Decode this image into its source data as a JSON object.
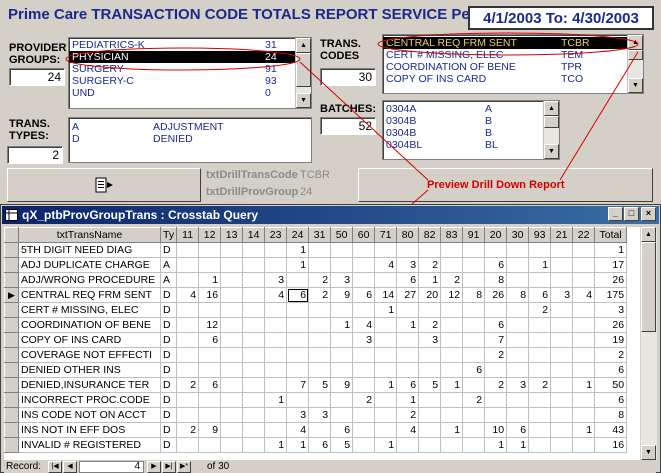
{
  "header": {
    "title": "Prime Care TRANSACTION CODE TOTALS REPORT SERVICE  Period:",
    "period": "4/1/2003 To: 4/30/2003"
  },
  "provider_groups": {
    "label_1": "PROVIDER",
    "label_2": "GROUPS:",
    "count": "24",
    "items": [
      {
        "name": "PEDIATRICS-K",
        "code": "31"
      },
      {
        "name": "PHYSICIAN",
        "code": "24"
      },
      {
        "name": "SURGERY",
        "code": "91"
      },
      {
        "name": "SURGERY-C",
        "code": "93"
      },
      {
        "name": "UND",
        "code": "0"
      }
    ]
  },
  "trans_codes": {
    "label_1": "TRANS.",
    "label_2": "CODES",
    "count": "30",
    "items": [
      {
        "name": "CENTRAL REQ FRM SENT",
        "code": "TCBR"
      },
      {
        "name": "CERT # MISSING, ELEC",
        "code": "TEM"
      },
      {
        "name": "COORDINATION OF BENE",
        "code": "TPR"
      },
      {
        "name": "COPY OF INS CARD",
        "code": "TCO"
      }
    ]
  },
  "trans_types": {
    "label_1": "TRANS.",
    "label_2": "TYPES:",
    "count": "2",
    "items": [
      {
        "code": "A",
        "name": "ADJUSTMENT"
      },
      {
        "code": "D",
        "name": "DENIED"
      }
    ]
  },
  "batches": {
    "label": "BATCHES:",
    "count": "52",
    "items": [
      {
        "name": "0304A",
        "code": "A"
      },
      {
        "name": "0304B",
        "code": "B"
      },
      {
        "name": "0304B",
        "code": "B"
      },
      {
        "name": "0304BL",
        "code": "BL"
      }
    ]
  },
  "drill": {
    "trans_code_label": "txtDrillTransCode",
    "trans_code_value": "TCBR",
    "prov_group_label": "txtDrillProvGroup",
    "prov_group_value": "24",
    "annotation": "Preview Drill Down Report"
  },
  "query_window": {
    "title": "qX_ptbProvGroupTrans : Crosstab Query",
    "columns": [
      "txtTransName",
      "Ty",
      "11",
      "12",
      "13",
      "14",
      "23",
      "24",
      "31",
      "50",
      "60",
      "71",
      "80",
      "82",
      "83",
      "91",
      "20",
      "30",
      "93",
      "21",
      "22",
      "Total"
    ],
    "rows": [
      [
        "5TH DIGIT NEED DIAG",
        "D",
        "",
        "",
        "",
        "",
        "",
        "1",
        "",
        "",
        "",
        "",
        "",
        "",
        "",
        "",
        "",
        "",
        "",
        "",
        "",
        "1"
      ],
      [
        "ADJ DUPLICATE CHARGE",
        "A",
        "",
        "",
        "",
        "",
        "",
        "1",
        "",
        "",
        "",
        "4",
        "3",
        "2",
        "",
        "",
        "6",
        "",
        "1",
        "",
        "",
        "17"
      ],
      [
        "ADJ/WRONG PROCEDURE",
        "A",
        "",
        "1",
        "",
        "",
        "3",
        "",
        "2",
        "3",
        "",
        "",
        "6",
        "1",
        "2",
        "",
        "8",
        "",
        "",
        "",
        "",
        "26"
      ],
      [
        "CENTRAL REQ FRM SENT",
        "D",
        "4",
        "16",
        "",
        "",
        "4",
        "6",
        "2",
        "9",
        "6",
        "14",
        "27",
        "20",
        "12",
        "8",
        "26",
        "8",
        "6",
        "3",
        "4",
        "175"
      ],
      [
        "CERT # MISSING, ELEC",
        "D",
        "",
        "",
        "",
        "",
        "",
        "",
        "",
        "",
        "",
        "1",
        "",
        "",
        "",
        "",
        "",
        "",
        "2",
        "",
        "",
        "3"
      ],
      [
        "COORDINATION OF BENE",
        "D",
        "",
        "12",
        "",
        "",
        "",
        "",
        "",
        "1",
        "4",
        "",
        "1",
        "2",
        "",
        "",
        "6",
        "",
        "",
        "",
        "",
        "26"
      ],
      [
        "COPY OF INS CARD",
        "D",
        "",
        "6",
        "",
        "",
        "",
        "",
        "",
        "",
        "3",
        "",
        "",
        "3",
        "",
        "",
        "7",
        "",
        "",
        "",
        "",
        "19"
      ],
      [
        "COVERAGE NOT EFFECTI",
        "D",
        "",
        "",
        "",
        "",
        "",
        "",
        "",
        "",
        "",
        "",
        "",
        "",
        "",
        "",
        "2",
        "",
        "",
        "",
        "",
        "2"
      ],
      [
        "DENIED OTHER INS",
        "D",
        "",
        "",
        "",
        "",
        "",
        "",
        "",
        "",
        "",
        "",
        "",
        "",
        "",
        "6",
        "",
        "",
        "",
        "",
        "",
        "6"
      ],
      [
        "DENIED,INSURANCE TER",
        "D",
        "2",
        "6",
        "",
        "",
        "",
        "7",
        "5",
        "9",
        "",
        "1",
        "6",
        "5",
        "1",
        "",
        "2",
        "3",
        "2",
        "",
        "1",
        "50"
      ],
      [
        "INCORRECT PROC.CODE",
        "D",
        "",
        "",
        "",
        "",
        "1",
        "",
        "",
        "",
        "2",
        "",
        "1",
        "",
        "",
        "2",
        "",
        "",
        "",
        "",
        "",
        "6"
      ],
      [
        "INS CODE NOT ON ACCT",
        "D",
        "",
        "",
        "",
        "",
        "",
        "3",
        "3",
        "",
        "",
        "",
        "2",
        "",
        "",
        "",
        "",
        "",
        "",
        "",
        "",
        "8"
      ],
      [
        "INS NOT IN EFF DOS",
        "D",
        "2",
        "9",
        "",
        "",
        "",
        "4",
        "",
        "6",
        "",
        "",
        "4",
        "",
        "1",
        "",
        "10",
        "6",
        "",
        "",
        "1",
        "43"
      ],
      [
        "INVALID # REGISTERED",
        "D",
        "",
        "",
        "",
        "",
        "1",
        "1",
        "6",
        "5",
        "",
        "1",
        "",
        "",
        "",
        "",
        "1",
        "1",
        "",
        "",
        "",
        "16"
      ]
    ],
    "current_row_index": 3,
    "highlighted_cell": "6",
    "record_label": "Record:",
    "record_current": "4",
    "record_total_text": "of  30"
  }
}
